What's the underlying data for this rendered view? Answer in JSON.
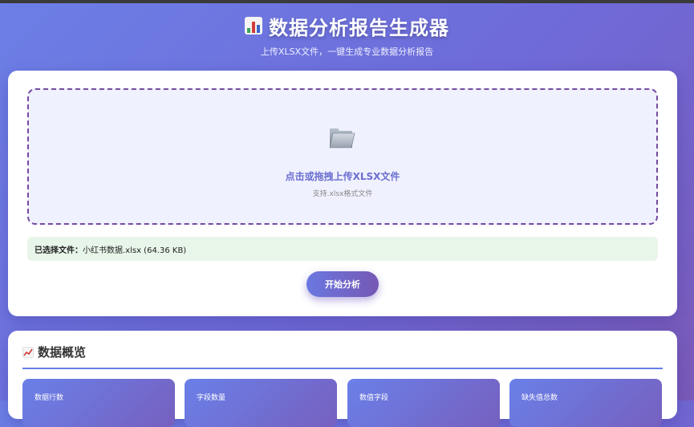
{
  "header": {
    "title": "数据分析报告生成器",
    "subtitle": "上传XLSX文件，一键生成专业数据分析报告",
    "title_icon": "bar-chart-icon"
  },
  "upload": {
    "icon": "folder-icon",
    "title": "点击或拖拽上传XLSX文件",
    "hint": "支持.xlsx格式文件"
  },
  "file": {
    "label": "已选择文件：",
    "value": "小红书数据.xlsx (64.36 KB)"
  },
  "actions": {
    "analyze_label": "开始分析"
  },
  "overview": {
    "icon": "line-chart-icon",
    "title": "数据概览",
    "stats": [
      {
        "label": "数据行数"
      },
      {
        "label": "字段数量"
      },
      {
        "label": "数值字段"
      },
      {
        "label": "缺失值总数"
      }
    ]
  },
  "colors": {
    "accent": "#667eea",
    "accent_dark": "#764ba2",
    "file_bg": "#e8f5e9",
    "dropzone_bg": "#f0f1fe"
  }
}
